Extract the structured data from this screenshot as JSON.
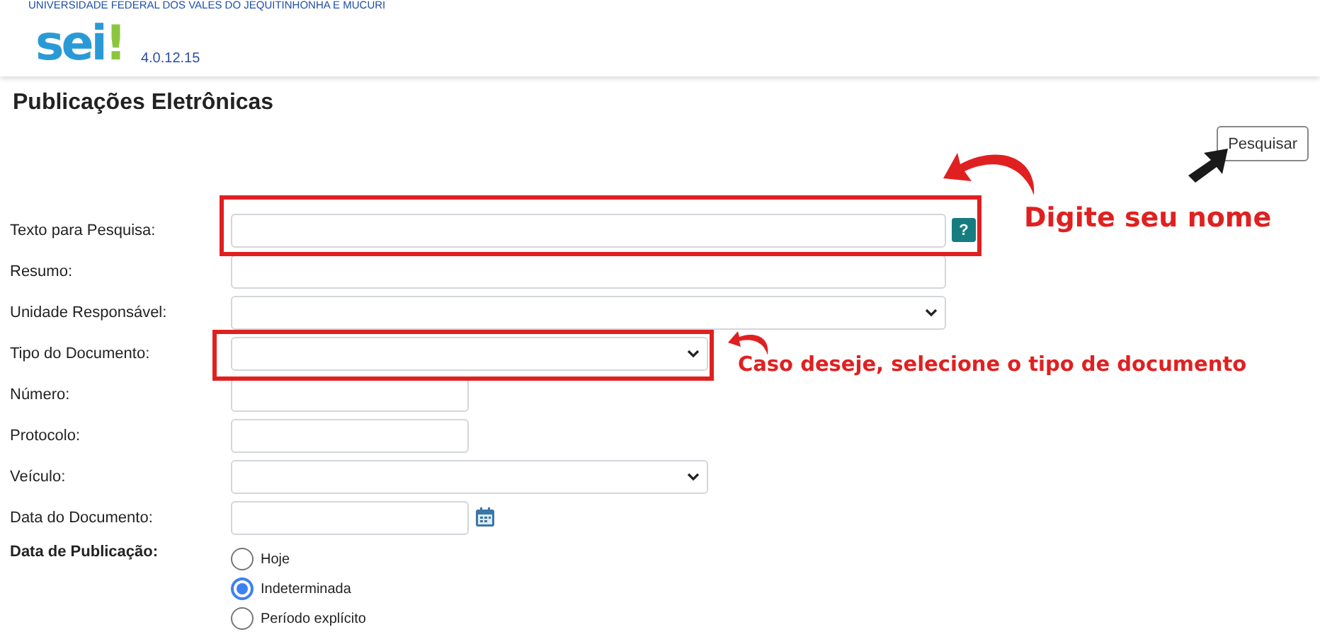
{
  "header": {
    "institution": "UNIVERSIDADE FEDERAL DOS VALES DO JEQUITINHONHA E MUCURI",
    "logo": {
      "text": "sei",
      "mark": "!"
    },
    "version": "4.0.12.15"
  },
  "title": "Publicações Eletrônicas",
  "search_button": "Pesquisar",
  "fields": [
    {
      "label": "Texto para Pesquisa:",
      "kind": "text",
      "help": "?"
    },
    {
      "label": "Resumo:",
      "kind": "text"
    },
    {
      "label": "Unidade Responsável:",
      "kind": "select"
    },
    {
      "label": "Tipo do Documento:",
      "kind": "select"
    },
    {
      "label": "Número:",
      "kind": "text"
    },
    {
      "label": "Protocolo:",
      "kind": "text"
    },
    {
      "label": "Veículo:",
      "kind": "select"
    },
    {
      "label": "Data do Documento:",
      "kind": "date"
    }
  ],
  "publication_date": {
    "label": "Data de Publicação:",
    "options": [
      {
        "label": "Hoje",
        "selected": false
      },
      {
        "label": "Indeterminada",
        "selected": true
      },
      {
        "label": "Período explícito",
        "selected": false
      }
    ]
  },
  "annotations": [
    {
      "text": "Digite seu nome"
    },
    {
      "text": "Caso deseje, selecione o tipo de documento"
    }
  ]
}
